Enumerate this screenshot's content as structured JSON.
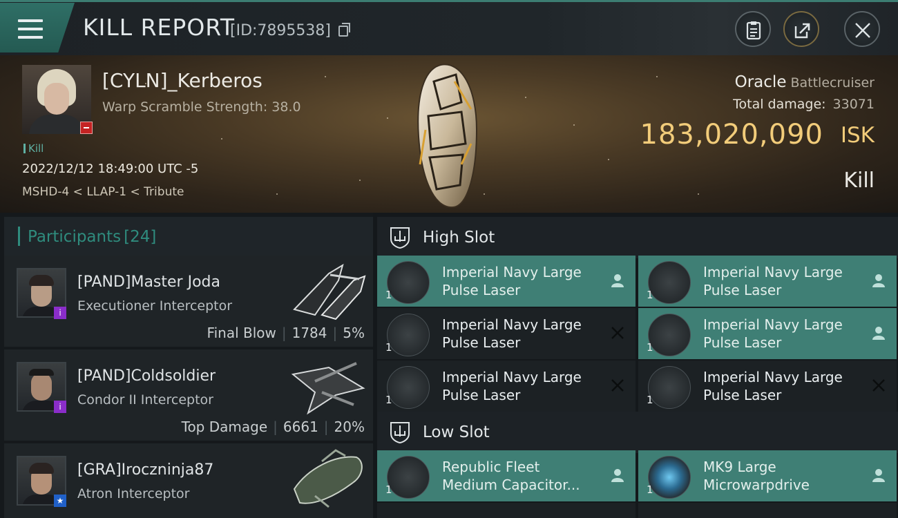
{
  "header": {
    "title": "KILL REPORT",
    "id_label": "[ID:7895538]"
  },
  "victim": {
    "name": "[CYLN]_Kerberos",
    "warp_scramble": "Warp Scramble Strength: 38.0",
    "kill_tag": "Kill",
    "datetime": "2022/12/12 18:49:00 UTC -5",
    "location": "MSHD-4 < LLAP-1 < Tribute",
    "ship_name": "Oracle",
    "ship_class": "Battlecruiser",
    "total_damage_label": "Total damage:",
    "total_damage_value": "33071",
    "isk_value": "183,020,090",
    "isk_unit": "ISK",
    "result": "Kill"
  },
  "participants": {
    "title": "Participants",
    "count": "[24]",
    "rows": [
      {
        "name": "[PAND]Master Joda",
        "ship": "Executioner Interceptor",
        "role": "Final Blow",
        "damage": "1784",
        "percent": "5%",
        "badge": "i",
        "badge_color": "#8a2dc9"
      },
      {
        "name": "[PAND]Coldsoldier",
        "ship": "Condor II Interceptor",
        "role": "Top Damage",
        "damage": "6661",
        "percent": "20%",
        "badge": "i",
        "badge_color": "#8a2dc9"
      },
      {
        "name": "[GRA]Iroczninja87",
        "ship": "Atron Interceptor",
        "role": "",
        "damage": "",
        "percent": "",
        "badge": "★",
        "badge_color": "#2060c8"
      }
    ]
  },
  "slots": {
    "high": {
      "title": "High Slot",
      "modules": [
        {
          "line1": "Imperial Navy Large",
          "line2": "Pulse Laser",
          "qty": "1",
          "status": "fitted"
        },
        {
          "line1": "Imperial Navy Large",
          "line2": "Pulse Laser",
          "qty": "1",
          "status": "fitted"
        },
        {
          "line1": "Imperial Navy Large",
          "line2": "Pulse Laser",
          "qty": "1",
          "status": "destroyed"
        },
        {
          "line1": "Imperial Navy Large",
          "line2": "Pulse Laser",
          "qty": "1",
          "status": "fitted"
        },
        {
          "line1": "Imperial Navy Large",
          "line2": "Pulse Laser",
          "qty": "1",
          "status": "destroyed"
        },
        {
          "line1": "Imperial Navy Large",
          "line2": "Pulse Laser",
          "qty": "1",
          "status": "destroyed"
        }
      ]
    },
    "low": {
      "title": "Low Slot",
      "modules": [
        {
          "line1": "Republic Fleet",
          "line2": "Medium Capacitor...",
          "qty": "1",
          "status": "fitted"
        },
        {
          "line1": "MK9 Large",
          "line2": "Microwarpdrive",
          "qty": "1",
          "status": "fitted"
        }
      ]
    }
  },
  "colors": {
    "accent": "#2f8c7e",
    "fitted_bg": "#3f7f75",
    "isk_gold": "#f2cc7a"
  }
}
